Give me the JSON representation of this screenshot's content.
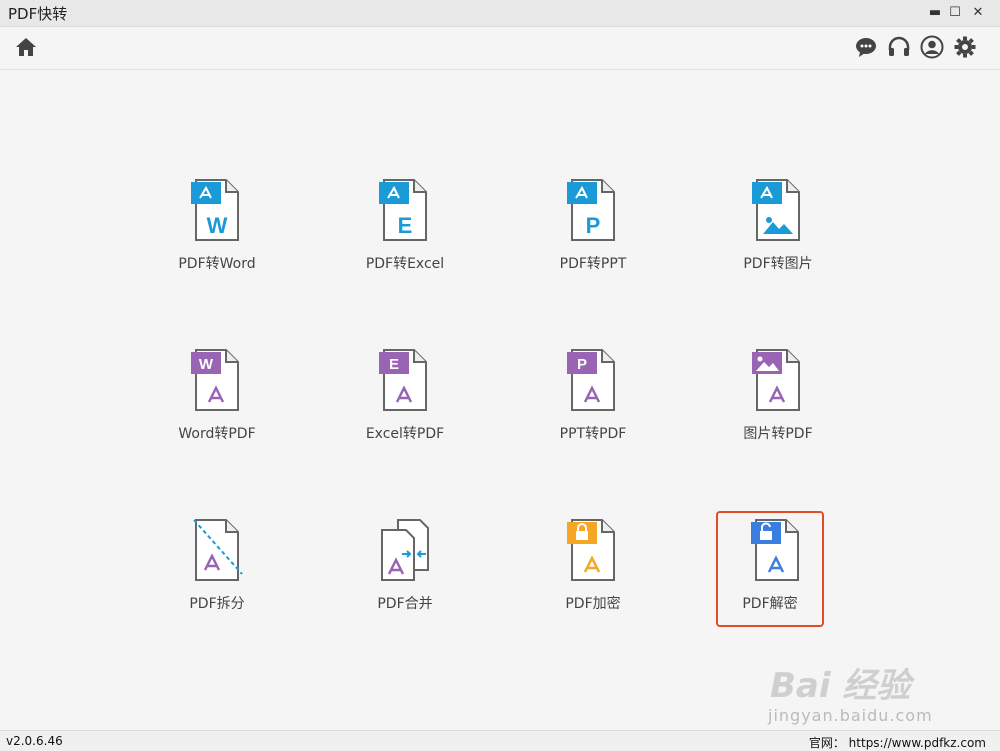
{
  "window": {
    "title": "PDF快转",
    "minimize": "▬",
    "maximize": "☐",
    "close": "✕"
  },
  "toolbar": {
    "home_icon": "home-icon",
    "right_icons": [
      "chat-icon",
      "headset-icon",
      "user-icon",
      "gear-icon"
    ]
  },
  "tools": [
    {
      "label": "PDF转Word",
      "badge": "W",
      "kind": "from-pdf"
    },
    {
      "label": "PDF转Excel",
      "badge": "E",
      "kind": "from-pdf"
    },
    {
      "label": "PDF转PPT",
      "badge": "P",
      "kind": "from-pdf"
    },
    {
      "label": "PDF转图片",
      "badge": "image",
      "kind": "from-pdf"
    },
    {
      "label": "Word转PDF",
      "badge": "W",
      "kind": "to-pdf"
    },
    {
      "label": "Excel转PDF",
      "badge": "E",
      "kind": "to-pdf"
    },
    {
      "label": "PPT转PDF",
      "badge": "P",
      "kind": "to-pdf"
    },
    {
      "label": "图片转PDF",
      "badge": "image",
      "kind": "to-pdf"
    },
    {
      "label": "PDF拆分",
      "badge": "split",
      "kind": "split"
    },
    {
      "label": "PDF合并",
      "badge": "merge",
      "kind": "merge"
    },
    {
      "label": "PDF加密",
      "badge": "lock",
      "kind": "encrypt"
    },
    {
      "label": "PDF解密",
      "badge": "unlock",
      "kind": "decrypt",
      "selected": true
    }
  ],
  "colors": {
    "blue": "#1a9bd7",
    "purple": "#9a64b5",
    "orange": "#f5a623",
    "decrypt_blue": "#3a7fe0",
    "selection": "#e14b28"
  },
  "status": {
    "version": "v2.0.6.46",
    "website_label": "官网：",
    "website_url": "https://www.pdfkz.com"
  },
  "watermark": {
    "brand": "Bai 经验",
    "url": "jingyan.baidu.com"
  }
}
